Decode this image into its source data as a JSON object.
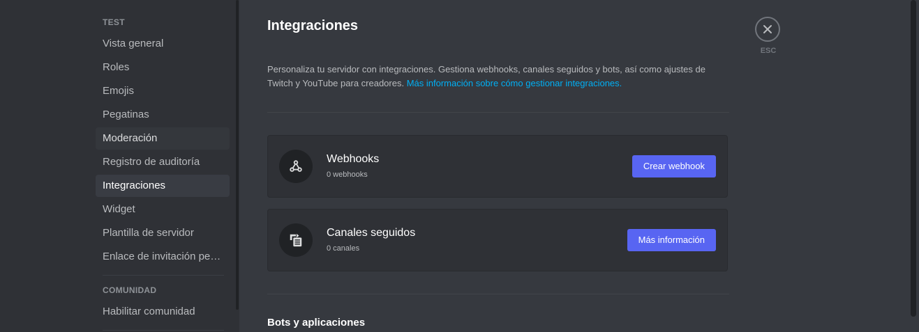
{
  "sidebar": {
    "sections": [
      {
        "header": "TEST",
        "items": [
          {
            "label": "Vista general"
          },
          {
            "label": "Roles"
          },
          {
            "label": "Emojis"
          },
          {
            "label": "Pegatinas"
          },
          {
            "label": "Moderación"
          },
          {
            "label": "Registro de auditoría"
          },
          {
            "label": "Integraciones"
          },
          {
            "label": "Widget"
          },
          {
            "label": "Plantilla de servidor"
          },
          {
            "label": "Enlace de invitación personalizado"
          }
        ]
      },
      {
        "header": "COMUNIDAD",
        "items": [
          {
            "label": "Habilitar comunidad"
          }
        ]
      }
    ]
  },
  "main": {
    "title": "Integraciones",
    "description": "Personaliza tu servidor con integraciones. Gestiona webhooks, canales seguidos y bots, así como ajustes de Twitch y YouTube para creadores.",
    "description_link": "Más información sobre cómo gestionar integraciones.",
    "cards": [
      {
        "title": "Webhooks",
        "subtitle": "0 webhooks",
        "button": "Crear webhook",
        "icon": "webhook-icon"
      },
      {
        "title": "Canales seguidos",
        "subtitle": "0 canales",
        "button": "Más información",
        "icon": "followed-channel-icon"
      }
    ],
    "bots_section_title": "Bots y aplicaciones"
  },
  "close": {
    "label": "ESC",
    "icon": "close-icon"
  },
  "colors": {
    "accent": "#5865f2",
    "link": "#00aff4",
    "background": "#36393f",
    "sidebar": "#2f3136"
  }
}
